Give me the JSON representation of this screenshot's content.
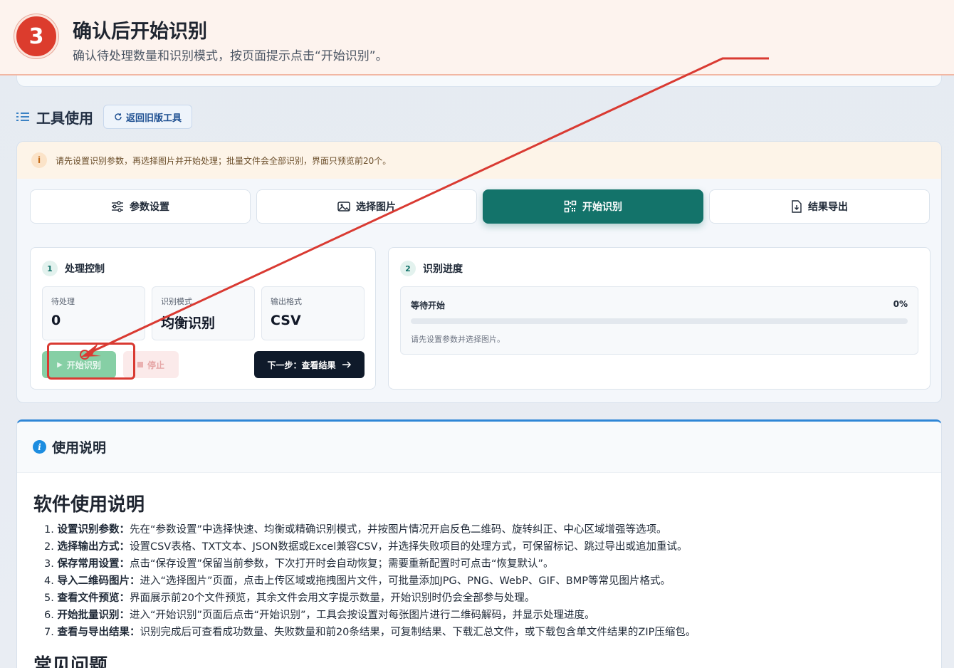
{
  "banner": {
    "step_number": "3",
    "title": "确认后开始识别",
    "subtitle": "确认待处理数量和识别模式，按页面提示点击“开始识别”。"
  },
  "tool_header": {
    "title": "工具使用",
    "back_button": "返回旧版工具"
  },
  "notice": {
    "icon": "info-circle-icon",
    "text": "请先设置识别参数，再选择图片并开始处理；批量文件会全部识别，界面只预览前20个。"
  },
  "tabs": [
    {
      "label": "参数设置",
      "icon": "sliders-icon"
    },
    {
      "label": "选择图片",
      "icon": "image-icon"
    },
    {
      "label": "开始识别",
      "icon": "qrcode-icon",
      "active": true
    },
    {
      "label": "结果导出",
      "icon": "file-download-icon"
    }
  ],
  "control_panel": {
    "number": "1",
    "title": "处理控制",
    "stats": [
      {
        "label": "待处理",
        "value": "0"
      },
      {
        "label": "识别模式",
        "value": "均衡识别"
      },
      {
        "label": "输出格式",
        "value": "CSV"
      }
    ],
    "start_button": "开始识别",
    "stop_button": "停止",
    "next_button": "下一步：查看结果"
  },
  "progress_panel": {
    "number": "2",
    "title": "识别进度",
    "status": "等待开始",
    "percent_text": "0%",
    "percent": 0,
    "hint": "请先设置参数并选择图片。"
  },
  "usage": {
    "header": "使用说明",
    "doc_title": "软件使用说明",
    "items": [
      {
        "num": "1.",
        "bold": "设置识别参数：",
        "text": "先在“参数设置”中选择快速、均衡或精确识别模式，并按图片情况开启反色二维码、旋转纠正、中心区域增强等选项。"
      },
      {
        "num": "2.",
        "bold": "选择输出方式：",
        "text": "设置CSV表格、TXT文本、JSON数据或Excel兼容CSV，并选择失败项目的处理方式，可保留标记、跳过导出或追加重试。"
      },
      {
        "num": "3.",
        "bold": "保存常用设置：",
        "text": "点击“保存设置”保留当前参数，下次打开时会自动恢复；需要重新配置时可点击“恢复默认”。"
      },
      {
        "num": "4.",
        "bold": "导入二维码图片：",
        "text": "进入“选择图片”页面，点击上传区域或拖拽图片文件，可批量添加JPG、PNG、WebP、GIF、BMP等常见图片格式。"
      },
      {
        "num": "5.",
        "bold": "查看文件预览：",
        "text": "界面展示前20个文件预览，其余文件会用文字提示数量，开始识别时仍会全部参与处理。"
      },
      {
        "num": "6.",
        "bold": "开始批量识别：",
        "text": "进入“开始识别”页面后点击“开始识别”，工具会按设置对每张图片进行二维码解码，并显示处理进度。"
      },
      {
        "num": "7.",
        "bold": "查看与导出结果：",
        "text": "识别完成后可查看成功数量、失败数量和前20条结果，可复制结果、下载汇总文件，或下载包含单文件结果的ZIP压缩包。"
      }
    ],
    "faq_title": "常见问题"
  },
  "colors": {
    "accent": "#13736a",
    "annotation": "#d93a32",
    "step_badge": "#dc3c2d"
  }
}
